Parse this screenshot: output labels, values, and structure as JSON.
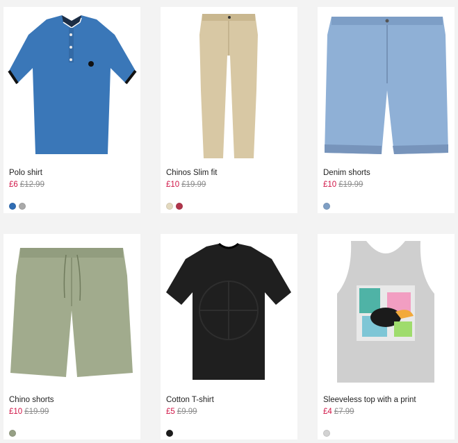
{
  "products": [
    {
      "name": "Polo shirt",
      "price": "£6",
      "was": "£12.99",
      "swatches": [
        "#2f6cb3",
        "#a9a9a9"
      ],
      "image": "polo-shirt-image"
    },
    {
      "name": "Chinos Slim fit",
      "price": "£10",
      "was": "£19.99",
      "swatches": [
        "#e3d9bf",
        "#b0354b"
      ],
      "image": "chinos-image"
    },
    {
      "name": "Denim shorts",
      "price": "£10",
      "was": "£19.99",
      "swatches": [
        "#7f9fc4"
      ],
      "image": "denim-shorts-image"
    },
    {
      "name": "Chino shorts",
      "price": "£10",
      "was": "£19.99",
      "swatches": [
        "#96a085"
      ],
      "image": "chino-shorts-image"
    },
    {
      "name": "Cotton T-shirt",
      "price": "£5",
      "was": "£9.99",
      "swatches": [
        "#1c1c1c"
      ],
      "image": "cotton-tshirt-image"
    },
    {
      "name": "Sleeveless top with a print",
      "price": "£4",
      "was": "£7.99",
      "swatches": [
        "#d2d2d2"
      ],
      "image": "sleeveless-top-image"
    }
  ],
  "colors": {
    "sale_price": "#d01345",
    "old_price": "#8a8a8a",
    "page_bg": "#f3f3f3"
  }
}
